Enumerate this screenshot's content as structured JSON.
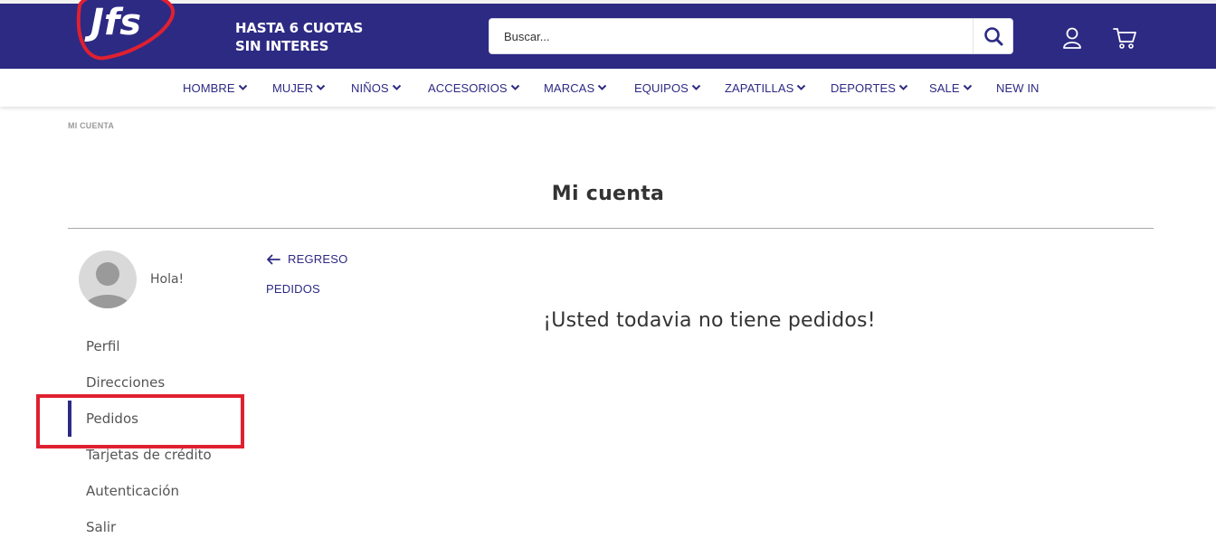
{
  "colors": {
    "brand": "#2d2a84",
    "logo_red": "#e02030",
    "highlight": "#e02030"
  },
  "header": {
    "logo_text": "Jfs",
    "promo_line1": "HASTA 6 CUOTAS",
    "promo_line2": "SIN INTERES",
    "search": {
      "placeholder": "Buscar..."
    },
    "icons": [
      "search-icon",
      "user-icon",
      "cart-icon"
    ]
  },
  "nav": {
    "items": [
      {
        "label": "HOMBRE",
        "has_dropdown": true
      },
      {
        "label": "MUJER",
        "has_dropdown": true
      },
      {
        "label": "NIÑOS",
        "has_dropdown": true
      },
      {
        "label": "ACCESORIOS",
        "has_dropdown": true
      },
      {
        "label": "MARCAS",
        "has_dropdown": true
      },
      {
        "label": "EQUIPOS",
        "has_dropdown": true
      },
      {
        "label": "ZAPATILLAS",
        "has_dropdown": true
      },
      {
        "label": "DEPORTES",
        "has_dropdown": true
      },
      {
        "label": "SALE",
        "has_dropdown": true
      },
      {
        "label": "NEW IN",
        "has_dropdown": false
      }
    ]
  },
  "breadcrumb": "MI CUENTA",
  "page_title": "Mi cuenta",
  "sidebar": {
    "greeting": "Hola!",
    "active": "Pedidos",
    "items": [
      {
        "label": "Perfil"
      },
      {
        "label": "Direcciones"
      },
      {
        "label": "Pedidos"
      },
      {
        "label": "Tarjetas de crédito"
      },
      {
        "label": "Autenticación"
      },
      {
        "label": "Salir"
      }
    ]
  },
  "main": {
    "back_label": "REGRESO",
    "section_label": "PEDIDOS",
    "empty_message": "¡Usted todavia no tiene pedidos!"
  }
}
